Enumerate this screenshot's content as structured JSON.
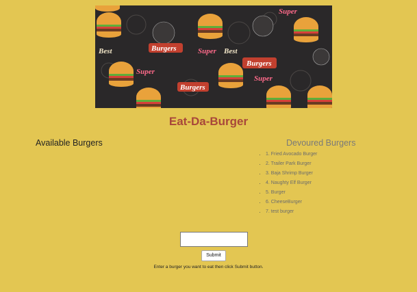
{
  "header": {
    "banner_alt": "Burgers pattern",
    "title": "Eat-Da-Burger"
  },
  "available": {
    "heading": "Available Burgers"
  },
  "devoured": {
    "heading": "Devoured Burgers",
    "items": [
      "1. Fried Avocado Burger",
      "2. Trailer Park Burger",
      "3. Baja Shrimp Burger",
      "4. Naughty Elf Burger",
      "5. Burger",
      "6. CheeseBurger",
      "7. test burger"
    ]
  },
  "form": {
    "input_value": "",
    "submit_label": "Submit",
    "instructions": "Enter a burger you want to eat then click Submit button."
  },
  "colors": {
    "background": "#e3c652",
    "title": "#a8473a"
  }
}
